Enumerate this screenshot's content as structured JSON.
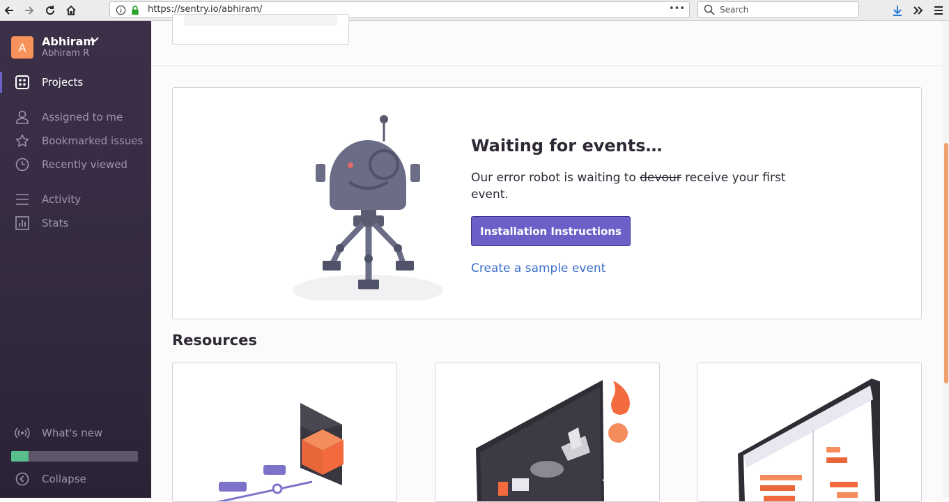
{
  "browser": {
    "url_host": "https://sentry.io",
    "url_path": "/abhiram/",
    "search_placeholder": "Search",
    "menu_dots": "•••"
  },
  "sidebar": {
    "org": {
      "avatar_letter": "A",
      "name": "Abhiram",
      "user": "Abhiram R"
    },
    "items": [
      {
        "label": "Projects",
        "icon": "projects-grid-icon",
        "active": true
      },
      {
        "label": "Assigned to me",
        "icon": "user-icon"
      },
      {
        "label": "Bookmarked issues",
        "icon": "star-icon"
      },
      {
        "label": "Recently viewed",
        "icon": "clock-icon"
      },
      {
        "label": "Activity",
        "icon": "list-icon"
      },
      {
        "label": "Stats",
        "icon": "bar-chart-icon"
      }
    ],
    "footer": {
      "whats_new": "What's new",
      "collapse": "Collapse",
      "progress": 0.14
    },
    "colors": {
      "accent": "#6c5fc7",
      "avatar": "#f7935a",
      "progress": "#57be8c"
    }
  },
  "main": {
    "waiting": {
      "title": "Waiting for events…",
      "desc_before": "Our error robot is waiting to ",
      "desc_strike": "devour",
      "desc_after": " receive your first event.",
      "install_button": "Installation Instructions",
      "sample_link": "Create a sample event"
    },
    "resources_title": "Resources"
  }
}
